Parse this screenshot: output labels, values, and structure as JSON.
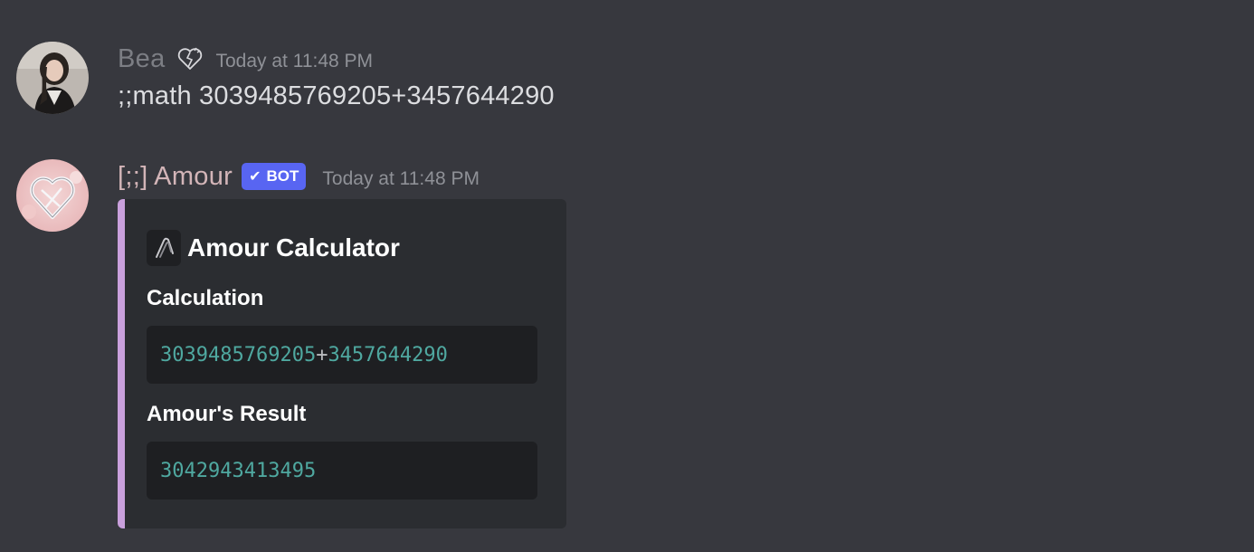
{
  "messages": [
    {
      "author": "Bea",
      "status_icon": "broken-heart-icon",
      "timestamp": "Today at 11:48 PM",
      "content": ";;math 3039485769205+3457644290"
    },
    {
      "author": "[;;] Amour",
      "badge": "BOT",
      "badge_icon": "check-icon",
      "timestamp": "Today at 11:48 PM",
      "embed": {
        "accent_color": "#c9a0dc",
        "author_icon": "paperclip-icon",
        "title": "Amour Calculator",
        "fields": [
          {
            "name": "Calculation",
            "value_parts": [
              "3039485769205",
              "+",
              "3457644290"
            ]
          },
          {
            "name": "Amour's Result",
            "value": "3042943413495"
          }
        ]
      }
    }
  ],
  "colors": {
    "background": "#37383e",
    "bot_badge": "#5865f2",
    "code_number": "#4fa8a0"
  }
}
